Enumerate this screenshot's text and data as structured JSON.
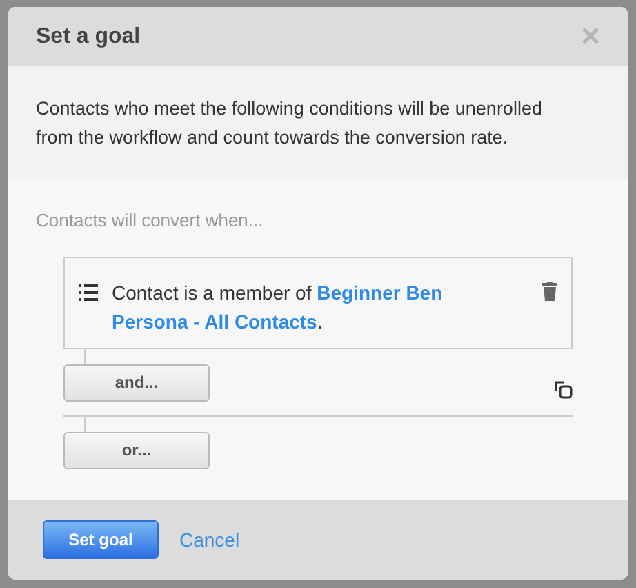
{
  "dialog": {
    "title": "Set a goal",
    "close": "×",
    "description": "Contacts who meet the following conditions will be unenrolled from the workflow and count towards the conversion rate.",
    "label": "Contacts will convert when...",
    "conditions": [
      {
        "text": "Contact is a member of **Beginner Ben Persona - All Contacts**."
      }
    ],
    "and_button": "and...",
    "or_button": "or...",
    "footer": {
      "primary": "Set goal",
      "cancel": "Cancel"
    }
  }
}
